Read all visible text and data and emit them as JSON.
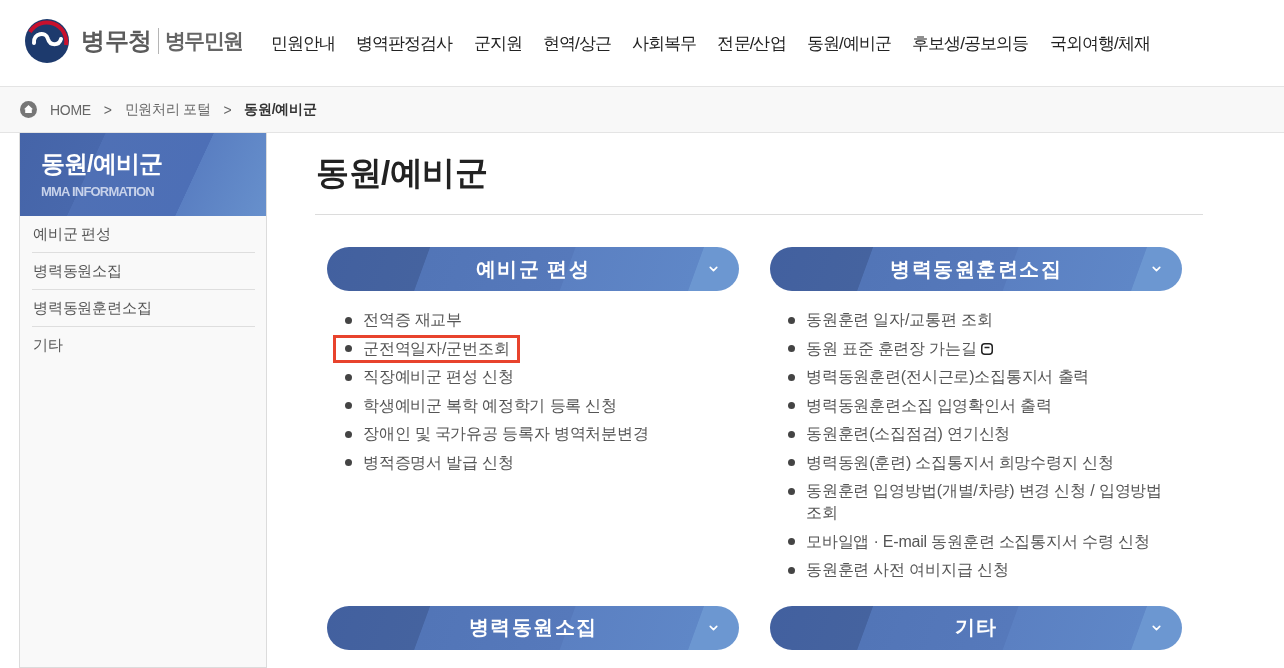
{
  "header": {
    "brand": "병무청",
    "service": "병무민원",
    "nav": [
      "민원안내",
      "병역판정검사",
      "군지원",
      "현역/상근",
      "사회복무",
      "전문/산업",
      "동원/예비군",
      "후보생/공보의등",
      "국외여행/체재"
    ]
  },
  "breadcrumb": [
    {
      "kind": "link",
      "text": "HOME"
    },
    {
      "kind": "separator",
      "text": ">"
    },
    {
      "kind": "link",
      "text": "민원처리 포털"
    },
    {
      "kind": "separator",
      "text": ">"
    },
    {
      "kind": "current",
      "text": "동원/예비군"
    }
  ],
  "sidebar": {
    "title": "동원/예비군",
    "subtitle": "MMA INFORMATION",
    "items": [
      "예비군 편성",
      "병력동원소집",
      "병력동원훈련소집",
      "기타"
    ]
  },
  "page_title": "동원/예비군",
  "sections": [
    {
      "title": "예비군 편성",
      "items": [
        {
          "text": "전역증 재교부",
          "highlighted": false,
          "new_window": false
        },
        {
          "text": "군전역일자/군번조회",
          "highlighted": true,
          "new_window": false
        },
        {
          "text": "직장예비군 편성 신청",
          "highlighted": false,
          "new_window": false
        },
        {
          "text": "학생예비군 복학 예정학기 등록 신청",
          "highlighted": false,
          "new_window": false
        },
        {
          "text": "장애인 및 국가유공 등록자 병역처분변경",
          "highlighted": false,
          "new_window": false
        },
        {
          "text": "병적증명서 발급 신청",
          "highlighted": false,
          "new_window": false
        }
      ]
    },
    {
      "title": "병력동원훈련소집",
      "items": [
        {
          "text": "동원훈련 일자/교통편 조회",
          "highlighted": false,
          "new_window": false
        },
        {
          "text": "동원 표준 훈련장 가는길",
          "highlighted": false,
          "new_window": true
        },
        {
          "text": "병력동원훈련(전시근로)소집통지서 출력",
          "highlighted": false,
          "new_window": false
        },
        {
          "text": "병력동원훈련소집 입영확인서 출력",
          "highlighted": false,
          "new_window": false
        },
        {
          "text": "동원훈련(소집점검) 연기신청",
          "highlighted": false,
          "new_window": false
        },
        {
          "text": "병력동원(훈련) 소집통지서 희망수령지 신청",
          "highlighted": false,
          "new_window": false
        },
        {
          "text": "동원훈련 입영방법(개별/차량) 변경 신청 / 입영방법 조회",
          "highlighted": false,
          "new_window": false
        },
        {
          "text": "모바일앱 · E-mail 동원훈련 소집통지서 수령 신청",
          "highlighted": false,
          "new_window": false
        },
        {
          "text": "동원훈련 사전 여비지급 신청",
          "highlighted": false,
          "new_window": false
        }
      ]
    },
    {
      "title": "병력동원소집"
    },
    {
      "title": "기타"
    }
  ]
}
